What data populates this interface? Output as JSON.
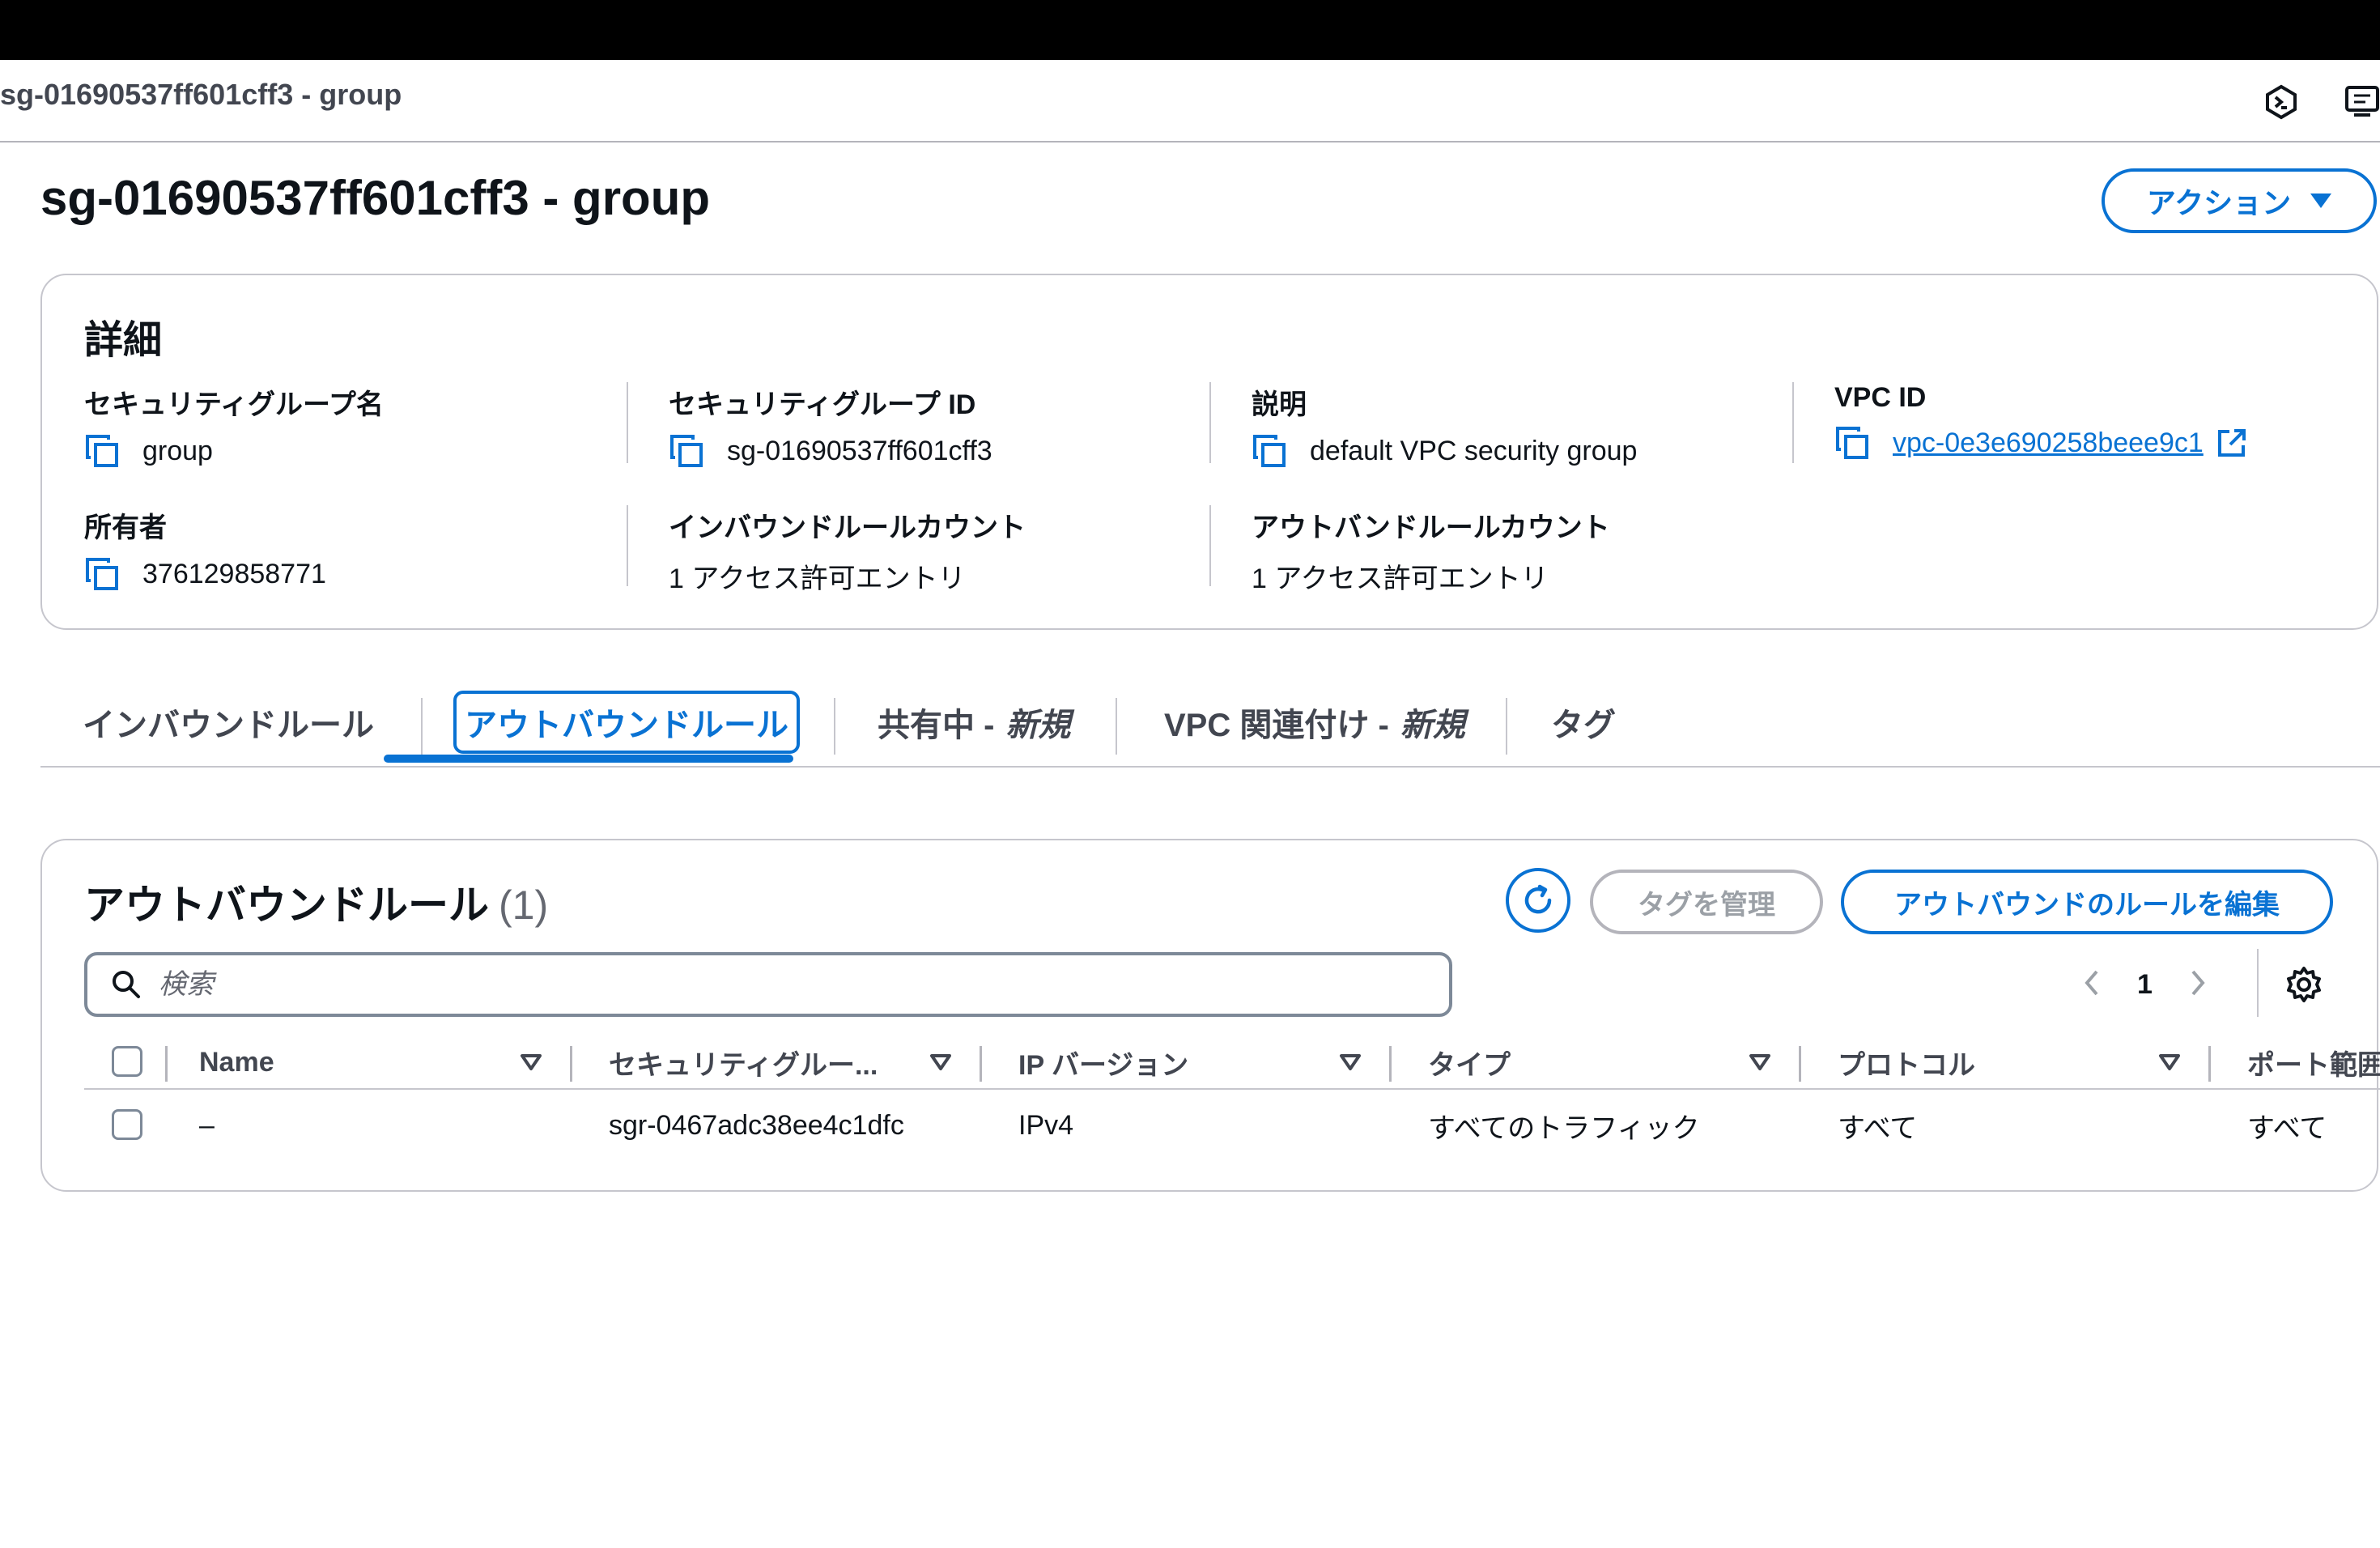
{
  "browser": {
    "tab_title": "sg-01690537ff601cff3 - group"
  },
  "header_icons": [
    "cloud-shell-icon",
    "notifications-icon"
  ],
  "page": {
    "title": "sg-01690537ff601cff3 - group",
    "actions_label": "アクション"
  },
  "details": {
    "heading": "詳細",
    "fields": {
      "sg_name_label": "セキュリティグループ名",
      "sg_name_value": "group",
      "sg_id_label": "セキュリティグループ ID",
      "sg_id_value": "sg-01690537ff601cff3",
      "description_label": "説明",
      "description_value": "default VPC security group",
      "vpc_id_label": "VPC ID",
      "vpc_id_value": "vpc-0e3e690258beee9c1",
      "owner_label": "所有者",
      "owner_value": "376129858771",
      "inbound_count_label": "インバウンドルールカウント",
      "inbound_count_value": "1 アクセス許可エントリ",
      "outbound_count_label": "アウトバンドルールカウント",
      "outbound_count_value": "1 アクセス許可エントリ"
    }
  },
  "tabs": [
    {
      "label": "インバウンドルール",
      "suffix": ""
    },
    {
      "label": "アウトバウンドルール",
      "suffix": "",
      "active": true
    },
    {
      "label": "共有中 -",
      "suffix": "新規"
    },
    {
      "label": "VPC 関連付け -",
      "suffix": "新規"
    },
    {
      "label": "タグ",
      "suffix": ""
    }
  ],
  "rules": {
    "title": "アウトバウンドルール",
    "count": "(1)",
    "manage_tags_label": "タグを管理",
    "edit_rules_label": "アウトバウンドのルールを編集",
    "search_placeholder": "検索",
    "page_number": "1",
    "columns": [
      "Name",
      "セキュリティグルー...",
      "IP バージョン",
      "タイプ",
      "プロトコル",
      "ポート範囲"
    ],
    "rows": [
      {
        "name": "–",
        "rule_id": "sgr-0467adc38ee4c1dfc",
        "ip_version": "IPv4",
        "type": "すべてのトラフィック",
        "protocol": "すべて",
        "port_range": "すべて"
      }
    ]
  },
  "colors": {
    "accent": "#0972d3",
    "border": "#c6c6cd",
    "text": "#0f141a",
    "muted": "#424650"
  }
}
